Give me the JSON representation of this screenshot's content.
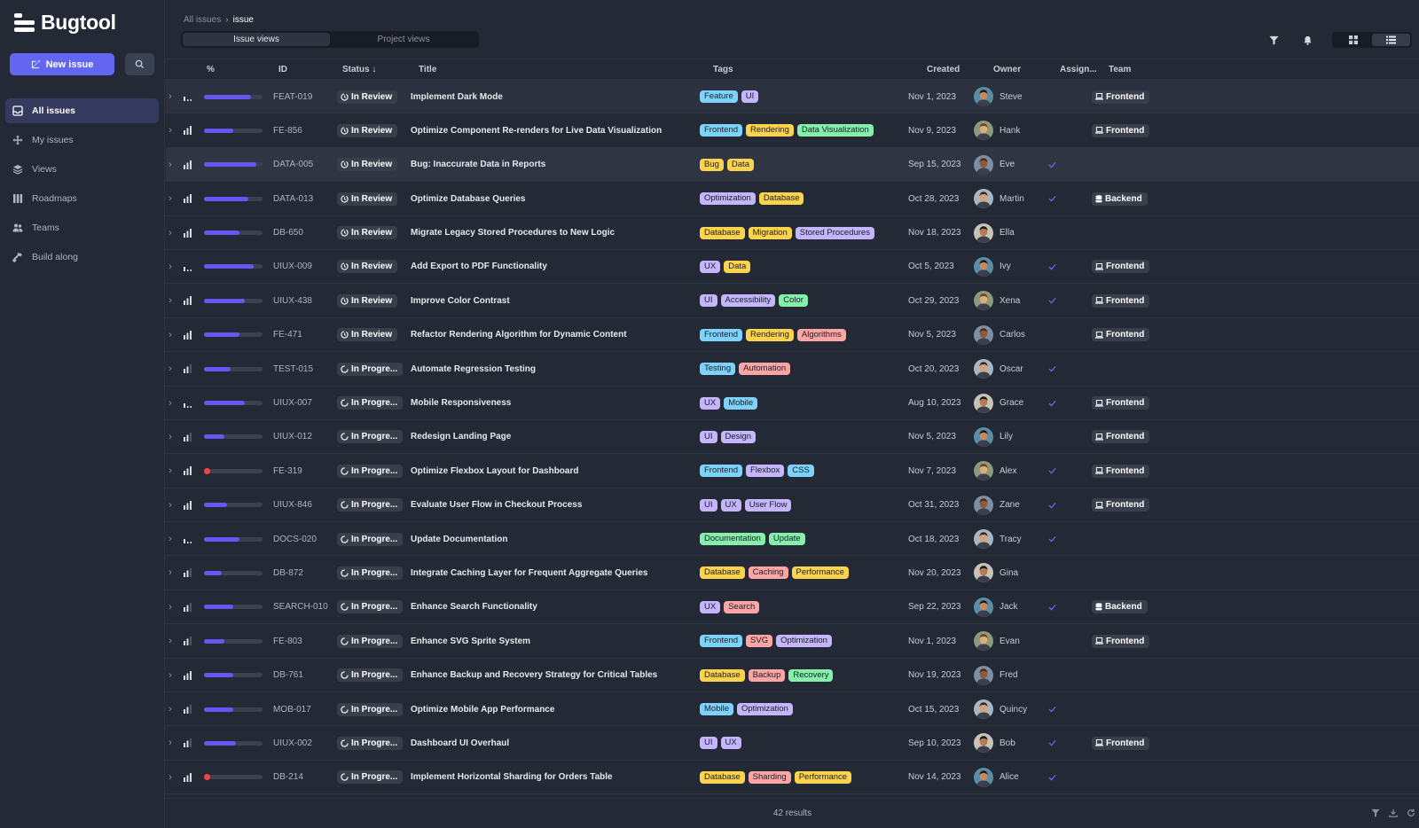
{
  "app": {
    "name": "Bugtool"
  },
  "sidebar": {
    "new_issue_label": "New issue",
    "items": [
      {
        "label": "All issues",
        "icon": "inbox-icon",
        "active": true
      },
      {
        "label": "My issues",
        "icon": "move-icon",
        "active": false
      },
      {
        "label": "Views",
        "icon": "layers-icon",
        "active": false
      },
      {
        "label": "Roadmaps",
        "icon": "columns-icon",
        "active": false
      },
      {
        "label": "Teams",
        "icon": "users-icon",
        "active": false
      },
      {
        "label": "Build along",
        "icon": "hammer-icon",
        "active": false
      }
    ]
  },
  "breadcrumb": {
    "parent": "All issues",
    "separator": "›",
    "current": "issue"
  },
  "view_tabs": [
    {
      "label": "Issue views",
      "active": true
    },
    {
      "label": "Project views",
      "active": false
    }
  ],
  "columns": {
    "progress": "%",
    "id": "ID",
    "status": "Status ↓",
    "title": "Title",
    "tags": "Tags",
    "created": "Created",
    "owner": "Owner",
    "assignee": "Assign...",
    "team": "Team"
  },
  "tag_colors": {
    "Feature": "#7dd3fc",
    "UI": "#c4b5fd",
    "Frontend": "#7dd3fc",
    "Rendering": "#fcd34d",
    "Data Visualization": "#86efac",
    "Bug": "#fcd34d",
    "Data": "#fcd34d",
    "Optimization": "#c4b5fd",
    "Database": "#fcd34d",
    "Migration": "#fcd34d",
    "Stored Procedures": "#c4b5fd",
    "UX": "#c4b5fd",
    "Accessibility": "#c4b5fd",
    "Color": "#86efac",
    "Algorithms": "#fca5a5",
    "Testing": "#7dd3fc",
    "Automation": "#fca5a5",
    "Mobile": "#7dd3fc",
    "Design": "#c4b5fd",
    "Flexbox": "#c4b5fd",
    "CSS": "#7dd3fc",
    "User Flow": "#c4b5fd",
    "Documentation": "#86efac",
    "Update": "#86efac",
    "Caching": "#fca5a5",
    "Performance": "#fcd34d",
    "Search": "#fca5a5",
    "SVG": "#fca5a5",
    "Backup": "#fca5a5",
    "Recovery": "#86efac",
    "Sharding": "#fca5a5"
  },
  "rows": [
    {
      "id": "FEAT-019",
      "priority": "medium",
      "progress": 80,
      "status": "In Review",
      "title": "Implement Dark Mode",
      "tags": [
        "Feature",
        "UI"
      ],
      "created": "Nov 1, 2023",
      "owner": "Steve",
      "assigned": false,
      "team": "Frontend",
      "state": "sel"
    },
    {
      "id": "FE-856",
      "priority": "high",
      "progress": 50,
      "status": "In Review",
      "title": "Optimize Component Re-renders for Live Data Visualization",
      "tags": [
        "Frontend",
        "Rendering",
        "Data Visualization"
      ],
      "created": "Nov 9, 2023",
      "owner": "Hank",
      "assigned": false,
      "team": "Frontend"
    },
    {
      "id": "DATA-005",
      "priority": "high",
      "progress": 90,
      "status": "In Review",
      "title": "Bug: Inaccurate Data in Reports",
      "tags": [
        "Bug",
        "Data"
      ],
      "created": "Sep 15, 2023",
      "owner": "Eve",
      "assigned": true,
      "team": "",
      "state": "hl"
    },
    {
      "id": "DATA-013",
      "priority": "high",
      "progress": 75,
      "status": "In Review",
      "title": "Optimize Database Queries",
      "tags": [
        "Optimization",
        "Database"
      ],
      "created": "Oct 28, 2023",
      "owner": "Martin",
      "assigned": true,
      "team": "Backend"
    },
    {
      "id": "DB-650",
      "priority": "high",
      "progress": 60,
      "status": "In Review",
      "title": "Migrate Legacy Stored Procedures to New Logic",
      "tags": [
        "Database",
        "Migration",
        "Stored Procedures"
      ],
      "created": "Nov 18, 2023",
      "owner": "Ella",
      "assigned": false,
      "team": ""
    },
    {
      "id": "UIUX-009",
      "priority": "medium",
      "progress": 85,
      "status": "In Review",
      "title": "Add Export to PDF Functionality",
      "tags": [
        "UX",
        "Data"
      ],
      "created": "Oct 5, 2023",
      "owner": "Ivy",
      "assigned": true,
      "team": "Frontend"
    },
    {
      "id": "UIUX-438",
      "priority": "high",
      "progress": 70,
      "status": "In Review",
      "title": "Improve Color Contrast",
      "tags": [
        "UI",
        "Accessibility",
        "Color"
      ],
      "created": "Oct 29, 2023",
      "owner": "Xena",
      "assigned": true,
      "team": "Frontend"
    },
    {
      "id": "FE-471",
      "priority": "high",
      "progress": 60,
      "status": "In Review",
      "title": "Refactor Rendering Algorithm for Dynamic Content",
      "tags": [
        "Frontend",
        "Rendering",
        "Algorithms"
      ],
      "created": "Nov 5, 2023",
      "owner": "Carlos",
      "assigned": false,
      "team": "Frontend"
    },
    {
      "id": "TEST-015",
      "priority": "low",
      "progress": 45,
      "status": "In Progre...",
      "title": "Automate Regression Testing",
      "tags": [
        "Testing",
        "Automation"
      ],
      "created": "Oct 20, 2023",
      "owner": "Oscar",
      "assigned": true,
      "team": ""
    },
    {
      "id": "UIUX-007",
      "priority": "medium",
      "progress": 70,
      "status": "In Progre...",
      "title": "Mobile Responsiveness",
      "tags": [
        "UX",
        "Mobile"
      ],
      "created": "Aug 10, 2023",
      "owner": "Grace",
      "assigned": true,
      "team": "Frontend"
    },
    {
      "id": "UIUX-012",
      "priority": "low",
      "progress": 35,
      "status": "In Progre...",
      "title": "Redesign Landing Page",
      "tags": [
        "UI",
        "Design"
      ],
      "created": "Nov 5, 2023",
      "owner": "Lily",
      "assigned": false,
      "team": "Frontend"
    },
    {
      "id": "FE-319",
      "priority": "high",
      "progress": 0,
      "status": "In Progre...",
      "title": "Optimize Flexbox Layout for Dashboard",
      "tags": [
        "Frontend",
        "Flexbox",
        "CSS"
      ],
      "created": "Nov 7, 2023",
      "owner": "Alex",
      "assigned": true,
      "team": "Frontend"
    },
    {
      "id": "UIUX-846",
      "priority": "high",
      "progress": 40,
      "status": "In Progre...",
      "title": "Evaluate User Flow in Checkout Process",
      "tags": [
        "UI",
        "UX",
        "User Flow"
      ],
      "created": "Oct 31, 2023",
      "owner": "Zane",
      "assigned": true,
      "team": "Frontend"
    },
    {
      "id": "DOCS-020",
      "priority": "medium",
      "progress": 60,
      "status": "In Progre...",
      "title": "Update Documentation",
      "tags": [
        "Documentation",
        "Update"
      ],
      "created": "Oct 18, 2023",
      "owner": "Tracy",
      "assigned": true,
      "team": ""
    },
    {
      "id": "DB-872",
      "priority": "low",
      "progress": 30,
      "status": "In Progre...",
      "title": "Integrate Caching Layer for Frequent Aggregate Queries",
      "tags": [
        "Database",
        "Caching",
        "Performance"
      ],
      "created": "Nov 20, 2023",
      "owner": "Gina",
      "assigned": false,
      "team": ""
    },
    {
      "id": "SEARCH-010",
      "priority": "low",
      "progress": 50,
      "status": "In Progre...",
      "title": "Enhance Search Functionality",
      "tags": [
        "UX",
        "Search"
      ],
      "created": "Sep 22, 2023",
      "owner": "Jack",
      "assigned": true,
      "team": "Backend"
    },
    {
      "id": "FE-803",
      "priority": "low",
      "progress": 35,
      "status": "In Progre...",
      "title": "Enhance SVG Sprite System",
      "tags": [
        "Frontend",
        "SVG",
        "Optimization"
      ],
      "created": "Nov 1, 2023",
      "owner": "Evan",
      "assigned": false,
      "team": "Frontend"
    },
    {
      "id": "DB-761",
      "priority": "high",
      "progress": 50,
      "status": "In Progre...",
      "title": "Enhance Backup and Recovery Strategy for Critical Tables",
      "tags": [
        "Database",
        "Backup",
        "Recovery"
      ],
      "created": "Nov 19, 2023",
      "owner": "Fred",
      "assigned": false,
      "team": ""
    },
    {
      "id": "MOB-017",
      "priority": "low",
      "progress": 50,
      "status": "In Progre...",
      "title": "Optimize Mobile App Performance",
      "tags": [
        "Mobile",
        "Optimization"
      ],
      "created": "Oct 15, 2023",
      "owner": "Quincy",
      "assigned": true,
      "team": ""
    },
    {
      "id": "UIUX-002",
      "priority": "low",
      "progress": 55,
      "status": "In Progre...",
      "title": "Dashboard UI Overhaul",
      "tags": [
        "UI",
        "UX"
      ],
      "created": "Sep 10, 2023",
      "owner": "Bob",
      "assigned": true,
      "team": "Frontend"
    },
    {
      "id": "DB-214",
      "priority": "high",
      "progress": 0,
      "status": "In Progre...",
      "title": "Implement Horizontal Sharding for Orders Table",
      "tags": [
        "Database",
        "Sharding",
        "Performance"
      ],
      "created": "Nov 14, 2023",
      "owner": "Alice",
      "assigned": true,
      "team": ""
    }
  ],
  "footer": {
    "results": "42 results"
  }
}
